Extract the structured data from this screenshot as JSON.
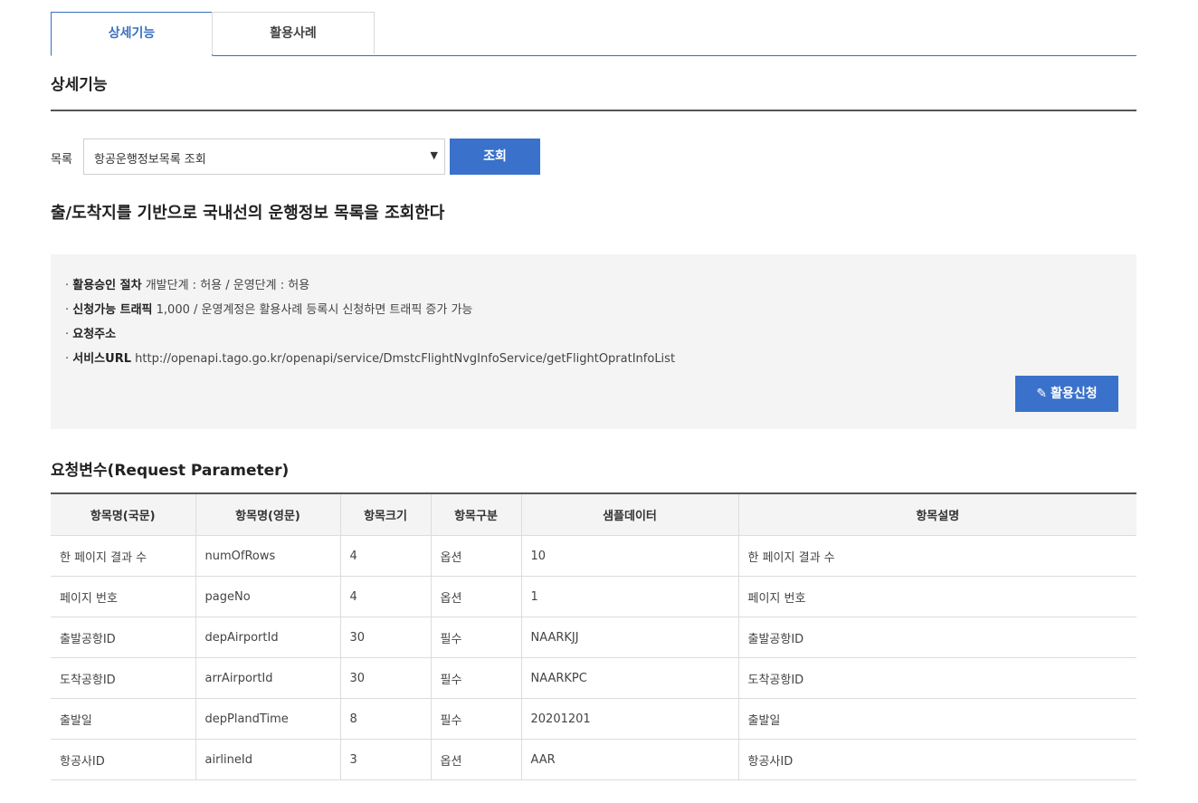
{
  "tabs": [
    {
      "label": "상세기능",
      "active": true
    },
    {
      "label": "활용사례",
      "active": false
    }
  ],
  "section_title": "상세기능",
  "list": {
    "label": "목록",
    "selected": "항공운행정보목록 조회",
    "search_button": "조회"
  },
  "description": "출/도착지를 기반으로 국내선의 운행정보 목록을 조회한다",
  "info": {
    "approval_label": "활용승인 절차",
    "approval_value": "개발단계 : 허용 / 운영단계 : 허용",
    "traffic_label": "신청가능 트래픽",
    "traffic_value": "1,000 / 운영계정은 활용사례 등록시 신청하면 트래픽 증가 가능",
    "request_label": "요청주소",
    "request_value": "",
    "url_label": "서비스URL",
    "url_value": "http://openapi.tago.go.kr/openapi/service/DmstcFlightNvgInfoService/getFlightOpratInfoList",
    "apply_button": "활용신청"
  },
  "params_title": "요청변수(Request Parameter)",
  "table": {
    "headers": [
      "항목명(국문)",
      "항목명(영문)",
      "항목크기",
      "항목구분",
      "샘플데이터",
      "항목설명"
    ],
    "rows": [
      [
        "한 페이지 결과 수",
        "numOfRows",
        "4",
        "옵션",
        "10",
        "한 페이지 결과 수"
      ],
      [
        "페이지 번호",
        "pageNo",
        "4",
        "옵션",
        "1",
        "페이지 번호"
      ],
      [
        "출발공항ID",
        "depAirportId",
        "30",
        "필수",
        "NAARKJJ",
        "출발공항ID"
      ],
      [
        "도착공항ID",
        "arrAirportId",
        "30",
        "필수",
        "NAARKPC",
        "도착공항ID"
      ],
      [
        "출발일",
        "depPlandTime",
        "8",
        "필수",
        "20201201",
        "출발일"
      ],
      [
        "항공사ID",
        "airlineId",
        "3",
        "옵션",
        "AAR",
        "항공사ID"
      ]
    ]
  },
  "colors": {
    "accent": "#3a72cb",
    "tab_active": "#3a6fc0",
    "info_bg": "#f4f4f4"
  }
}
